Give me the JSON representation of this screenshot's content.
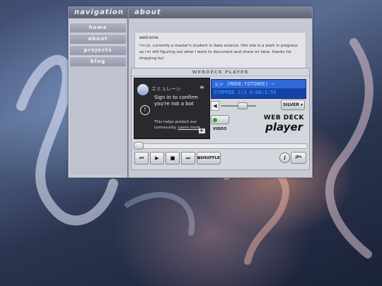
{
  "nav": {
    "title": "navigation",
    "items": [
      {
        "label": "home"
      },
      {
        "label": "about"
      },
      {
        "label": "projects"
      },
      {
        "label": "blog"
      }
    ]
  },
  "about": {
    "title": "about",
    "heading": "welcome",
    "text": "i'm jo, currently a master's student in data science. this site is a work in progress as i'm still figuring out what i want to document and share on here. thanks for dropping by!"
  },
  "player": {
    "title": "WEBDECK PLAYER",
    "video": {
      "channel_title": "エミュレーシ",
      "captcha_title": "Sign in to confirm you're not a bot",
      "captcha_text": "This helps protect our community.",
      "captcha_link": "Learn more"
    },
    "lcd": {
      "line1": "ョン (MODE:TOTONEE) ~",
      "line2": "STOPPED 1/3 0:00/3:55"
    },
    "skin_label": "SILVER",
    "video_toggle_label": "VIDEO",
    "logo_top": "WEB DECK",
    "logo_bottom": "player",
    "shuffle_label": "SHUFFLE",
    "info_label": "i",
    "lang_label": "JP",
    "controls": {
      "prev": "⏮",
      "play": "▶",
      "stop": "■",
      "next": "⏭"
    },
    "volume": 0.6,
    "progress": 0.0,
    "colors": {
      "lcd_bg": "#1743a8",
      "lcd_text": "#3fb0ff",
      "video_dot": "#2aa02a"
    }
  }
}
